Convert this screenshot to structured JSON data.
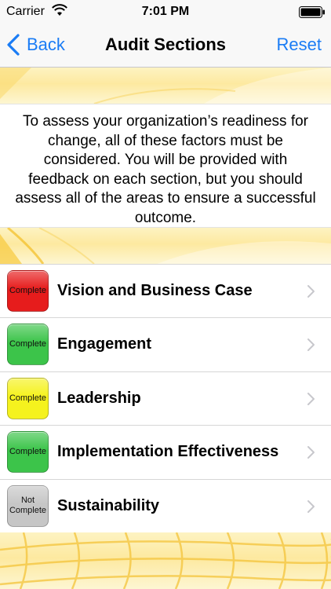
{
  "status_bar": {
    "carrier": "Carrier",
    "time": "7:01 PM",
    "icons": [
      "wifi-icon",
      "battery-icon"
    ]
  },
  "nav": {
    "back_label": "Back",
    "title": "Audit Sections",
    "reset_label": "Reset"
  },
  "intro_text": "To assess your organization’s readiness for change, all of these factors must be considered. You will be provided with feedback on each section, but you should assess all of the areas to ensure a successful outcome.",
  "sections": [
    {
      "label": "Vision and Business Case",
      "status": "Complete",
      "color": "#e61c1c"
    },
    {
      "label": "Engagement",
      "status": "Complete",
      "color": "#3cc44a"
    },
    {
      "label": "Leadership",
      "status": "Complete",
      "color": "#f5f21e"
    },
    {
      "label": "Implementation Effectiveness",
      "status": "Complete",
      "color": "#3cc44a"
    },
    {
      "label": "Sustainability",
      "status": "Not Complete",
      "color": "#c6c6c6"
    }
  ],
  "colors": {
    "accent": "#1a7cf5",
    "banner": "#fde9a0"
  }
}
